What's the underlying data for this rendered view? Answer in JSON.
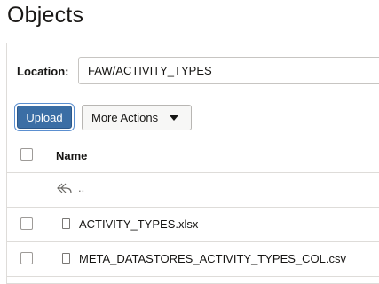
{
  "page": {
    "title": "Objects"
  },
  "location": {
    "label": "Location:",
    "value": "FAW/ACTIVITY_TYPES"
  },
  "toolbar": {
    "upload_label": "Upload",
    "more_actions_label": "More Actions"
  },
  "table": {
    "header": {
      "name": "Name"
    },
    "parent_link": "..",
    "rows": [
      {
        "name": "ACTIVITY_TYPES.xlsx",
        "icon": "file-icon"
      },
      {
        "name": "META_DATASTORES_ACTIVITY_TYPES_COL.csv",
        "icon": "file-icon"
      }
    ]
  },
  "colors": {
    "primary_button": "#3b6ea5",
    "border": "#dedcd9"
  }
}
